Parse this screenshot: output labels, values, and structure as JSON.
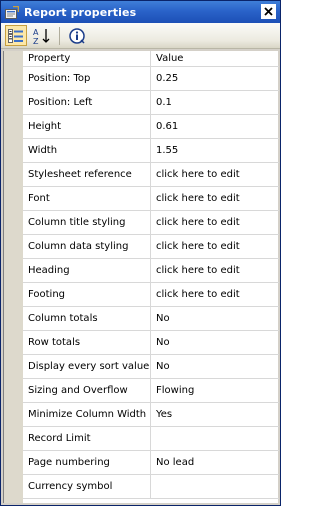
{
  "window": {
    "title": "Report properties"
  },
  "toolbar": {
    "buttons": [
      {
        "icon": "categorized-icon",
        "active": true
      },
      {
        "icon": "sort-alphabetical-icon",
        "active": false
      },
      {
        "icon": "info-icon",
        "active": false
      }
    ],
    "sort_label": "AZ"
  },
  "grid": {
    "columns": [
      "Property",
      "Value"
    ],
    "rows": [
      {
        "property": "Position: Top",
        "value": "0.25"
      },
      {
        "property": "Position: Left",
        "value": "0.1"
      },
      {
        "property": "Height",
        "value": "0.61"
      },
      {
        "property": "Width",
        "value": "1.55"
      },
      {
        "property": "Stylesheet reference",
        "value": "click here to edit"
      },
      {
        "property": "Font",
        "value": "click here to edit"
      },
      {
        "property": "Column title styling",
        "value": "click here to edit"
      },
      {
        "property": "Column data styling",
        "value": "click here to edit"
      },
      {
        "property": "Heading",
        "value": "click here to edit"
      },
      {
        "property": "Footing",
        "value": "click here to edit"
      },
      {
        "property": "Column totals",
        "value": "No"
      },
      {
        "property": "Row totals",
        "value": "No"
      },
      {
        "property": "Display every sort value",
        "value": "No"
      },
      {
        "property": "Sizing and Overflow",
        "value": "Flowing"
      },
      {
        "property": "Minimize Column Width",
        "value": "Yes"
      },
      {
        "property": "Record Limit",
        "value": ""
      },
      {
        "property": "Page numbering",
        "value": "No lead"
      },
      {
        "property": "Currency symbol",
        "value": ""
      }
    ]
  },
  "colors": {
    "titlebar": "#2a63c9",
    "gutter": "#ddd9cc",
    "gridline": "#d8d8d8"
  }
}
